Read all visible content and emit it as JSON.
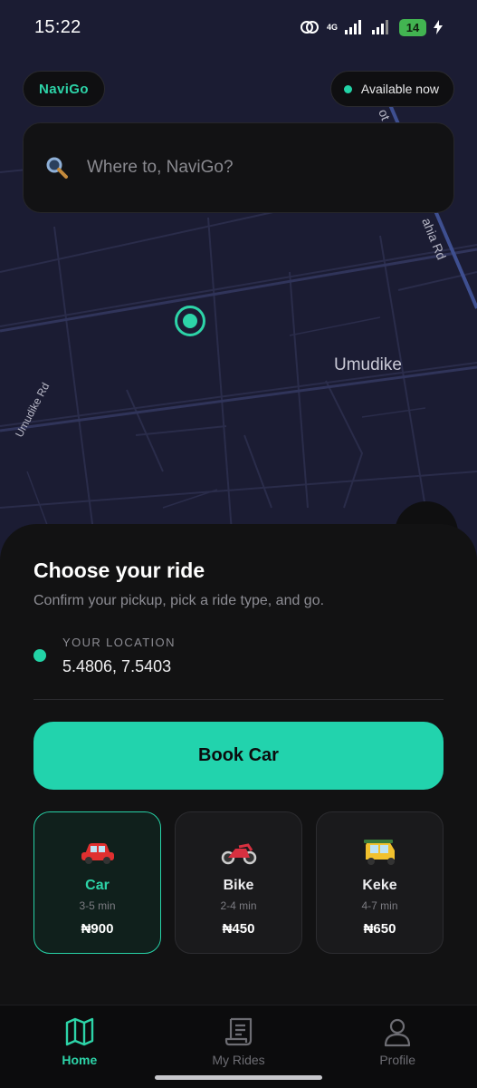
{
  "status_bar": {
    "time": "15:22",
    "network": "4G",
    "battery": "14"
  },
  "header": {
    "brand": "NaviGo",
    "availability": "Available now"
  },
  "search": {
    "placeholder": "Where to, NaviGo?"
  },
  "map": {
    "place_label": "Umudike",
    "road_labels": [
      "Umudike Rd",
      "ahia Rd",
      "ot"
    ]
  },
  "sheet": {
    "title": "Choose your ride",
    "subtitle": "Confirm your pickup, pick a ride type, and go.",
    "location_label": "YOUR LOCATION",
    "location_value": "5.4806, 7.5403",
    "book_button": "Book Car",
    "rides": [
      {
        "name": "Car",
        "eta": "3-5 min",
        "price": "₦900",
        "icon": "car-icon",
        "selected": true
      },
      {
        "name": "Bike",
        "eta": "2-4 min",
        "price": "₦450",
        "icon": "motorcycle-icon",
        "selected": false
      },
      {
        "name": "Keke",
        "eta": "4-7 min",
        "price": "₦650",
        "icon": "auto-rickshaw-icon",
        "selected": false
      }
    ]
  },
  "nav": {
    "items": [
      {
        "label": "Home",
        "icon": "map-icon",
        "active": true
      },
      {
        "label": "My Rides",
        "icon": "receipt-icon",
        "active": false
      },
      {
        "label": "Profile",
        "icon": "user-icon",
        "active": false
      }
    ]
  },
  "colors": {
    "accent": "#22d3ad",
    "map_bg": "#1b1c33",
    "sheet_bg": "#121213"
  }
}
